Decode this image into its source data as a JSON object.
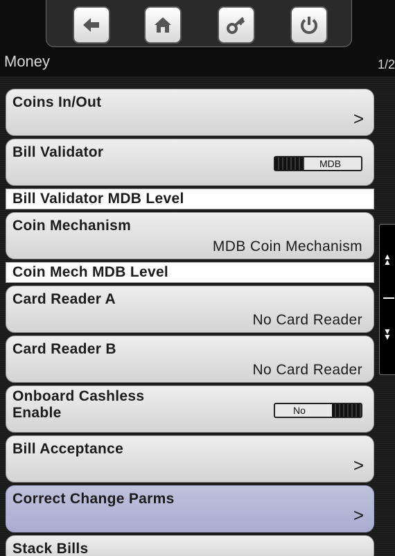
{
  "header": {
    "title": "Money",
    "page_indicator": "1/2",
    "nav_buttons": [
      {
        "name": "back-arrow-icon"
      },
      {
        "name": "home-icon"
      },
      {
        "name": "key-icon"
      },
      {
        "name": "power-icon"
      }
    ]
  },
  "items": {
    "coins_in_out": {
      "label": "Coins In/Out",
      "arrow": ">"
    },
    "bill_validator": {
      "label": "Bill Validator",
      "toggle_value": "MDB"
    },
    "bill_validator_mdb_level": {
      "label": "Bill Validator MDB Level"
    },
    "coin_mechanism": {
      "label": "Coin Mechanism",
      "value": "MDB Coin Mechanism"
    },
    "coin_mech_mdb_level": {
      "label": "Coin Mech MDB Level"
    },
    "card_reader_a": {
      "label": "Card Reader A",
      "value": "No Card Reader"
    },
    "card_reader_b": {
      "label": "Card Reader B",
      "value": "No Card Reader"
    },
    "onboard_cashless": {
      "label_line1": "Onboard Cashless",
      "label_line2": "Enable",
      "toggle_value": "No"
    },
    "bill_acceptance": {
      "label": "Bill Acceptance",
      "arrow": ">"
    },
    "correct_change_parms": {
      "label": "Correct Change Parms",
      "arrow": ">"
    },
    "stack_bills": {
      "label": "Stack Bills"
    }
  },
  "colors": {
    "highlight": "#b4b7d6",
    "item_bg": "#e4e4e4",
    "background": "#000000"
  }
}
